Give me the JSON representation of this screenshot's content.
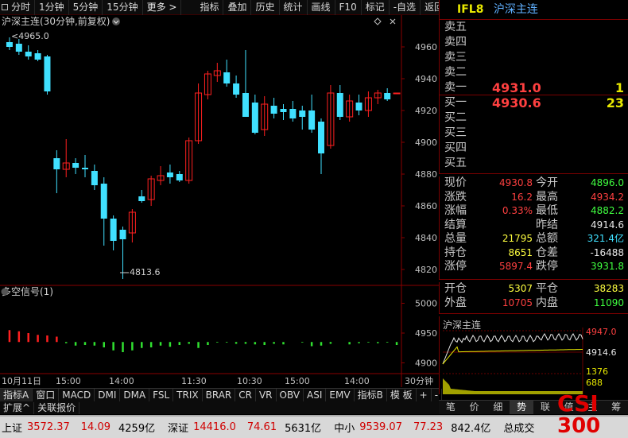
{
  "toolbar": {
    "items": [
      "分时",
      "1分钟",
      "5分钟",
      "15分钟",
      "更多 >",
      "指标",
      "叠加",
      "历史",
      "统计",
      "画线",
      "F10",
      "标记",
      "-自选",
      "返回"
    ]
  },
  "header": {
    "code": "IFL8",
    "name": "沪深主连"
  },
  "chart_header": {
    "title": "沪深主连(30分钟,前复权)",
    "start_label": "<4965.0"
  },
  "price_axis": {
    "ticks": [
      "4960",
      "4940",
      "4920",
      "4900",
      "4880",
      "4860",
      "4840",
      "4820"
    ]
  },
  "low_label": "4813.6",
  "indicator": {
    "title": "多空信号(1)",
    "ticks": [
      "5000",
      "4950",
      "4900"
    ]
  },
  "x_labels": [
    "10月11日",
    "15:00",
    "14:00",
    "11:30",
    "10:30",
    "15:00",
    "14:00"
  ],
  "period_label": "30分钟",
  "chart_data": {
    "type": "candlestick",
    "title": "沪深主连(30分钟,前复权)",
    "ylim": [
      4810,
      4970
    ],
    "candles": [
      {
        "o": 4963,
        "h": 4966,
        "l": 4958,
        "c": 4960,
        "up": false
      },
      {
        "o": 4962,
        "h": 4965,
        "l": 4955,
        "c": 4957,
        "up": false
      },
      {
        "o": 4957,
        "h": 4961,
        "l": 4952,
        "c": 4954,
        "up": false
      },
      {
        "o": 4956,
        "h": 4958,
        "l": 4951,
        "c": 4952,
        "up": false
      },
      {
        "o": 4954,
        "h": 4955,
        "l": 4930,
        "c": 4932,
        "up": false
      },
      {
        "o": 4890,
        "h": 4895,
        "l": 4868,
        "c": 4883,
        "up": false
      },
      {
        "o": 4883,
        "h": 4902,
        "l": 4878,
        "c": 4887,
        "up": true
      },
      {
        "o": 4887,
        "h": 4890,
        "l": 4880,
        "c": 4884,
        "up": false
      },
      {
        "o": 4884,
        "h": 4892,
        "l": 4878,
        "c": 4883,
        "up": false
      },
      {
        "o": 4882,
        "h": 4886,
        "l": 4870,
        "c": 4873,
        "up": false
      },
      {
        "o": 4874,
        "h": 4878,
        "l": 4835,
        "c": 4852,
        "up": false
      },
      {
        "o": 4852,
        "h": 4854,
        "l": 4832,
        "c": 4838,
        "up": false
      },
      {
        "o": 4845,
        "h": 4847,
        "l": 4814,
        "c": 4839,
        "up": false
      },
      {
        "o": 4843,
        "h": 4858,
        "l": 4837,
        "c": 4856,
        "up": true
      },
      {
        "o": 4866,
        "h": 4870,
        "l": 4862,
        "c": 4863,
        "up": false
      },
      {
        "o": 4864,
        "h": 4879,
        "l": 4860,
        "c": 4877,
        "up": true
      },
      {
        "o": 4876,
        "h": 4885,
        "l": 4873,
        "c": 4879,
        "up": true
      },
      {
        "o": 4878,
        "h": 4886,
        "l": 4874,
        "c": 4881,
        "up": false
      },
      {
        "o": 4880,
        "h": 4882,
        "l": 4875,
        "c": 4876,
        "up": false
      },
      {
        "o": 4876,
        "h": 4903,
        "l": 4874,
        "c": 4901,
        "up": true
      },
      {
        "o": 4901,
        "h": 4937,
        "l": 4899,
        "c": 4931,
        "up": true
      },
      {
        "o": 4930,
        "h": 4945,
        "l": 4927,
        "c": 4943,
        "up": true
      },
      {
        "o": 4942,
        "h": 4950,
        "l": 4938,
        "c": 4945,
        "up": true
      },
      {
        "o": 4944,
        "h": 4952,
        "l": 4935,
        "c": 4937,
        "up": false
      },
      {
        "o": 4937,
        "h": 4942,
        "l": 4928,
        "c": 4930,
        "up": false
      },
      {
        "o": 4931,
        "h": 4958,
        "l": 4920,
        "c": 4916,
        "up": false
      },
      {
        "o": 4925,
        "h": 4930,
        "l": 4905,
        "c": 4906,
        "up": false
      },
      {
        "o": 4908,
        "h": 4929,
        "l": 4904,
        "c": 4924,
        "up": true
      },
      {
        "o": 4923,
        "h": 4928,
        "l": 4915,
        "c": 4918,
        "up": false
      },
      {
        "o": 4919,
        "h": 4924,
        "l": 4914,
        "c": 4921,
        "up": false
      },
      {
        "o": 4921,
        "h": 4926,
        "l": 4913,
        "c": 4915,
        "up": false
      },
      {
        "o": 4916,
        "h": 4923,
        "l": 4908,
        "c": 4920,
        "up": false
      },
      {
        "o": 4920,
        "h": 4930,
        "l": 4906,
        "c": 4908,
        "up": false
      },
      {
        "o": 4913,
        "h": 4915,
        "l": 4880,
        "c": 4893,
        "up": false
      },
      {
        "o": 4898,
        "h": 4936,
        "l": 4896,
        "c": 4931,
        "up": true
      },
      {
        "o": 4931,
        "h": 4936,
        "l": 4914,
        "c": 4916,
        "up": false
      },
      {
        "o": 4916,
        "h": 4930,
        "l": 4913,
        "c": 4926,
        "up": true
      },
      {
        "o": 4925,
        "h": 4930,
        "l": 4917,
        "c": 4920,
        "up": false
      },
      {
        "o": 4920,
        "h": 4932,
        "l": 4916,
        "c": 4928,
        "up": true
      },
      {
        "o": 4928,
        "h": 4933,
        "l": 4924,
        "c": 4931,
        "up": true
      },
      {
        "o": 4931,
        "h": 4934,
        "l": 4926,
        "c": 4927,
        "up": false
      },
      {
        "o": 4931,
        "h": 4931,
        "l": 4931,
        "c": 4931,
        "up": true
      }
    ],
    "signals": [
      4950,
      4948,
      4945,
      4942,
      4938,
      4935,
      4935,
      4935,
      4935,
      4935,
      4935,
      4935,
      4935,
      4935,
      4935,
      4935,
      4935,
      4935,
      4935,
      4935,
      4935,
      4935,
      4935,
      4935,
      4935,
      4935,
      4935,
      4935,
      4935,
      4935,
      4935,
      4935,
      4935,
      4935,
      4935,
      4935,
      4935,
      4935,
      4935,
      4935,
      4935,
      4935
    ],
    "signal_dir": [
      1,
      1,
      1,
      1,
      1,
      1,
      1,
      1,
      1,
      1,
      1,
      1,
      1,
      1,
      1,
      1,
      1,
      1,
      1,
      1,
      1,
      1,
      1,
      1,
      1,
      1,
      1,
      1,
      1,
      1,
      1,
      1,
      1,
      1,
      1,
      1,
      1,
      1,
      1,
      1,
      1,
      1
    ],
    "signal_values": [
      4955,
      4953,
      4950,
      4947,
      4946,
      4944,
      4933,
      4929,
      4930,
      4929,
      4926,
      4921,
      4918,
      4921,
      4925,
      4926,
      4929,
      4927,
      4930,
      4932,
      4925,
      4930,
      4934,
      4934,
      4932,
      4932,
      4931,
      4930,
      4932,
      4931,
      4935,
      4934,
      4928,
      4929,
      4932,
      4935,
      4931,
      4933,
      4934,
      4933,
      4934,
      4930
    ],
    "signal_ylim": [
      4890,
      5010
    ]
  },
  "order_book": {
    "asks": [
      {
        "label": "卖五",
        "price": "",
        "vol": ""
      },
      {
        "label": "卖四",
        "price": "",
        "vol": ""
      },
      {
        "label": "卖三",
        "price": "",
        "vol": ""
      },
      {
        "label": "卖二",
        "price": "",
        "vol": ""
      },
      {
        "label": "卖一",
        "price": "4931.0",
        "vol": "1"
      }
    ],
    "bids": [
      {
        "label": "买一",
        "price": "4930.6",
        "vol": "23"
      },
      {
        "label": "买二",
        "price": "",
        "vol": ""
      },
      {
        "label": "买三",
        "price": "",
        "vol": ""
      },
      {
        "label": "买四",
        "price": "",
        "vol": ""
      },
      {
        "label": "买五",
        "price": "",
        "vol": ""
      }
    ]
  },
  "stats": [
    {
      "l1": "现价",
      "v1": "4930.8",
      "c1": "red",
      "l2": "今开",
      "v2": "4896.0",
      "c2": "green"
    },
    {
      "l1": "涨跌",
      "v1": "16.2",
      "c1": "red",
      "l2": "最高",
      "v2": "4934.2",
      "c2": "red"
    },
    {
      "l1": "涨幅",
      "v1": "0.33%",
      "c1": "red",
      "l2": "最低",
      "v2": "4882.2",
      "c2": "green"
    },
    {
      "l1": "结算",
      "v1": "",
      "c1": "white",
      "l2": "昨结",
      "v2": "4914.6",
      "c2": "white"
    },
    {
      "l1": "总量",
      "v1": "21795",
      "c1": "yellow",
      "l2": "总额",
      "v2": "321.4亿",
      "c2": "cyan"
    },
    {
      "l1": "持仓",
      "v1": "8651",
      "c1": "yellow",
      "l2": "仓差",
      "v2": "-16488",
      "c2": "white"
    },
    {
      "l1": "涨停",
      "v1": "5897.4",
      "c1": "red",
      "l2": "跌停",
      "v2": "3931.8",
      "c2": "green"
    }
  ],
  "trade": [
    {
      "l1": "开仓",
      "v1": "5307",
      "l2": "平仓",
      "v2": "38283"
    },
    {
      "l1": "外盘",
      "v1": "10705",
      "c1": "red",
      "l2": "内盘",
      "v2": "11090",
      "c2": "green"
    }
  ],
  "mini": {
    "title": "沪深主连",
    "p_high": "4947.0",
    "p_mid": "4914.6",
    "v_high": "1376",
    "v_mid": "688"
  },
  "indicator_tabs": [
    "指标A",
    "窗口",
    "MACD",
    "DMI",
    "DMA",
    "FSL",
    "TRIX",
    "BRAR",
    "CR",
    "VR",
    "OBV",
    "ASI",
    "EMV",
    "指标B",
    "模 板",
    "+",
    "-"
  ],
  "sub_tabs": [
    "扩展^",
    "关联报价"
  ],
  "right_tabs": [
    "笔",
    "价",
    "细",
    "势",
    "联",
    "值",
    "主",
    "筹"
  ],
  "ticker": [
    {
      "name": "上证",
      "price": "3572.37",
      "change": "14.09",
      "amount": "4259亿"
    },
    {
      "name": "深证",
      "price": "14416.0",
      "change": "74.61",
      "amount": "5631亿"
    },
    {
      "name": "中小",
      "price": "9539.07",
      "change": "77.23",
      "amount": "842.4亿"
    },
    {
      "name": "总成交",
      "price": "",
      "change": "",
      "amount": ""
    }
  ],
  "logo": {
    "line1": "CSI",
    "line2": "300"
  },
  "colors": {
    "up": "#ff2020",
    "down": "#40e0ff",
    "grid": "#6a0000",
    "axis_text": "#c0c0c0"
  }
}
